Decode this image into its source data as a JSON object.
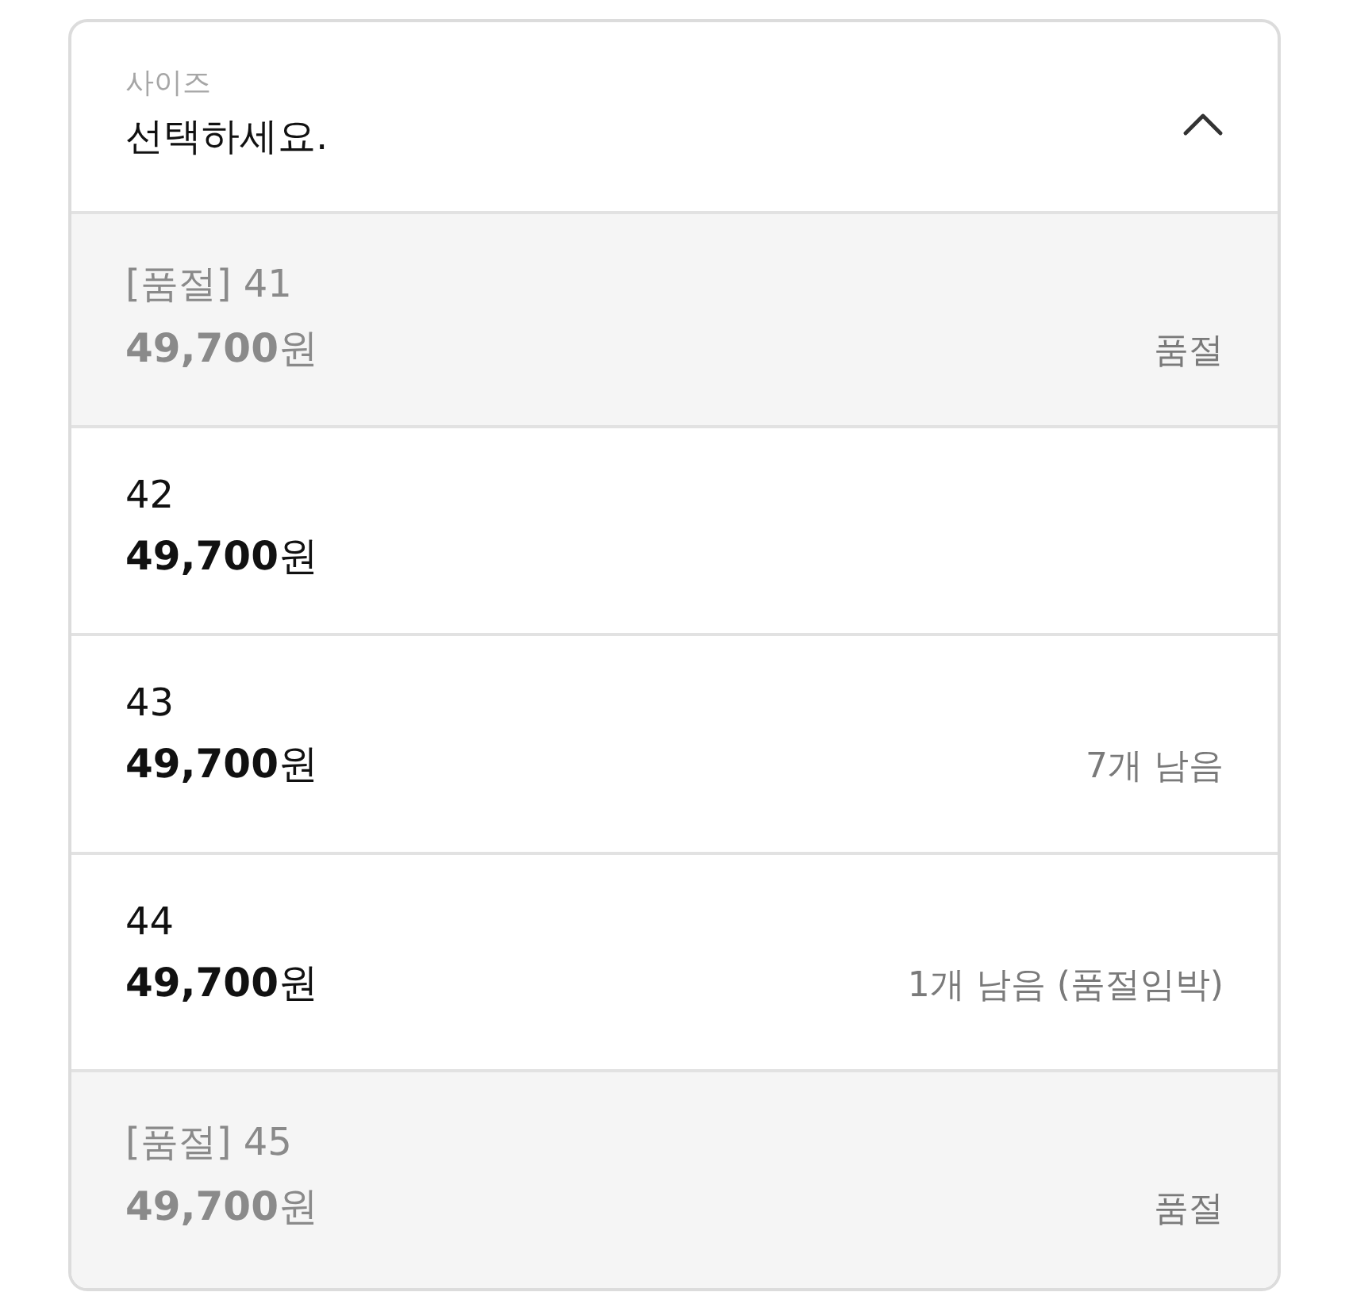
{
  "dropdown": {
    "label": "사이즈",
    "value": "선택하세요.",
    "expanded": true
  },
  "options": [
    {
      "name": "[품절] 41",
      "price": "49,700",
      "currency": "원",
      "status": "품절",
      "sold_out": true
    },
    {
      "name": "42",
      "price": "49,700",
      "currency": "원",
      "sold_out": false
    },
    {
      "name": "43",
      "price": "49,700",
      "currency": "원",
      "status": "7개 남음",
      "sold_out": false
    },
    {
      "name": "44",
      "price": "49,700",
      "currency": "원",
      "status": "1개 남음 (품절임박)",
      "sold_out": false
    },
    {
      "name": "[품절] 45",
      "price": "49,700",
      "currency": "원",
      "status": "품절",
      "sold_out": true
    }
  ]
}
